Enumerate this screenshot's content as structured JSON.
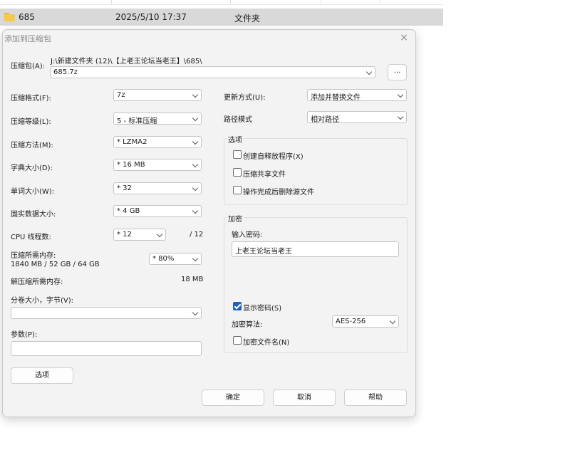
{
  "explorer": {
    "row": {
      "name": "685",
      "modified": "2025/5/10 17:37",
      "type": "文件夹"
    }
  },
  "dialog": {
    "title": "添加到压缩包",
    "close_glyph": "×",
    "archive": {
      "label": "压缩包(A):",
      "path": "J:\\新建文件夹 (12)\\【上老王论坛当老王】\\685\\",
      "filename": "685.7z",
      "browse_label": "..."
    },
    "left": {
      "format": {
        "label": "压缩格式(F):",
        "value": "7z"
      },
      "level": {
        "label": "压缩等级(L):",
        "value": "5 - 标准压缩"
      },
      "method": {
        "label": "压缩方法(M):",
        "value": "* LZMA2"
      },
      "dict": {
        "label": "字典大小(D):",
        "value": "* 16 MB"
      },
      "word": {
        "label": "单词大小(W):",
        "value": "* 32"
      },
      "solid": {
        "label": "固实数据大小:",
        "value": "* 4 GB"
      },
      "threads": {
        "label": "CPU 线程数:",
        "value": "* 12",
        "total": "/ 12"
      },
      "mem_compress": {
        "label": "压缩所需内存:",
        "detail": "1840 MB / 52 GB / 64 GB",
        "value": "* 80%"
      },
      "mem_decompress": {
        "label": "解压缩所需内存:",
        "value": "18 MB"
      },
      "volume": {
        "label": "分卷大小，字节(V):",
        "value": ""
      },
      "params": {
        "label": "参数(P):",
        "value": ""
      },
      "options_button": "选项"
    },
    "right": {
      "update": {
        "label": "更新方式(U):",
        "value": "添加并替换文件"
      },
      "path_mode": {
        "label": "路径模式",
        "value": "相对路径"
      },
      "options_group": {
        "title": "选项",
        "sfx": {
          "label": "创建自释放程序(X)",
          "checked": false
        },
        "shared": {
          "label": "压缩共享文件",
          "checked": false
        },
        "delete": {
          "label": "操作完成后删除源文件",
          "checked": false
        }
      },
      "encrypt_group": {
        "title": "加密",
        "password_label": "输入密码:",
        "password": "上老王论坛当老王",
        "show_password": {
          "label": "显示密码(S)",
          "checked": true
        },
        "method_label": "加密算法:",
        "method": "AES-256",
        "encrypt_names": {
          "label": "加密文件名(N)",
          "checked": false
        }
      }
    },
    "buttons": {
      "ok": "确定",
      "cancel": "取消",
      "help": "帮助"
    }
  }
}
